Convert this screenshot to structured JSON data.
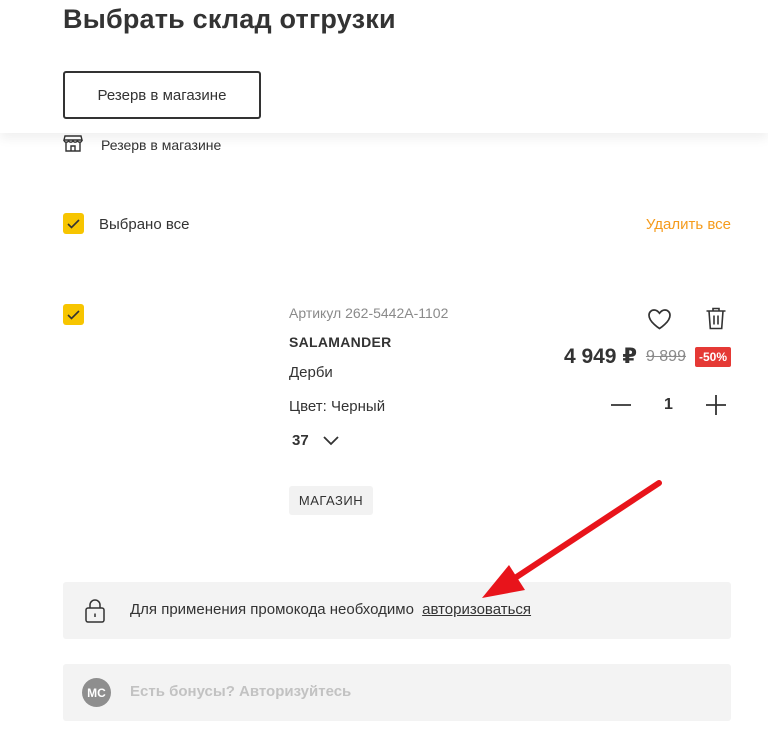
{
  "header": {
    "title": "Выбрать склад отгрузки",
    "tab_label": "Резерв в магазине"
  },
  "store_row": {
    "icon": "store-icon",
    "label": "Резерв в магазине"
  },
  "selection": {
    "select_all_label": "Выбрано все",
    "delete_all_label": "Удалить все"
  },
  "product": {
    "article": "Артикул 262-5442A-1102",
    "brand": "SALAMANDER",
    "name": "Дерби",
    "color": "Цвет: Черный",
    "size": "37",
    "availability_chip": "МАГАЗИН",
    "price": "4 949 ₽",
    "old_price": "9 899",
    "discount": "-50%",
    "quantity": "1"
  },
  "promo": {
    "text": "Для применения промокода необходимо",
    "link": "авторизоваться"
  },
  "bonus": {
    "logo_text": "МС",
    "text": "Есть бонусы? Авторизуйтесь"
  },
  "colors": {
    "checkbox": "#f7c500",
    "delete_all": "#f59b1c",
    "discount_badge": "#e53935",
    "annotation_arrow": "#e8141b"
  },
  "annotation": {
    "arrow_target": "promo-login-link"
  }
}
